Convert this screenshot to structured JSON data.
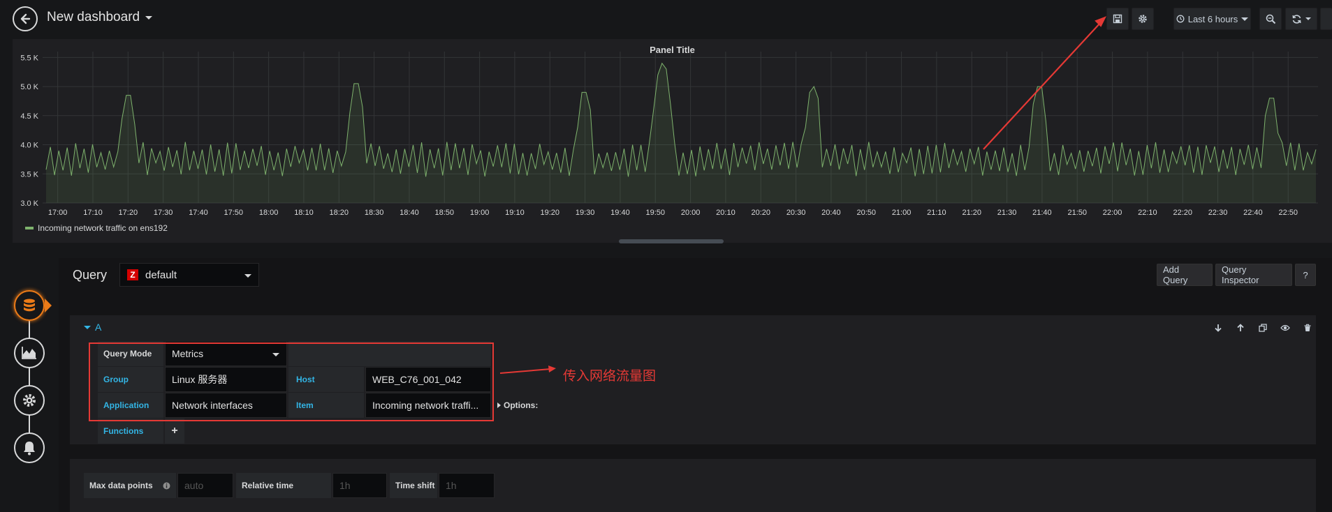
{
  "navbar": {
    "title": "New dashboard",
    "time_range": "Last 6 hours",
    "icons": [
      "back-arrow-icon",
      "save-icon",
      "gear-icon",
      "clock-icon",
      "zoom-out-icon",
      "refresh-icon"
    ]
  },
  "panel": {
    "title": "Panel Title",
    "legend": "Incoming network traffic on ens192"
  },
  "chart_data": {
    "type": "line",
    "title": "Panel Title",
    "xlabel": "",
    "ylabel": "",
    "ylim": [
      3.0,
      5.6
    ],
    "y_ticks": [
      "3.0 K",
      "3.5 K",
      "4.0 K",
      "4.5 K",
      "5.0 K",
      "5.5 K"
    ],
    "x_ticks": [
      "17:00",
      "17:10",
      "17:20",
      "17:30",
      "17:40",
      "17:50",
      "18:00",
      "18:10",
      "18:20",
      "18:30",
      "18:40",
      "18:50",
      "19:00",
      "19:10",
      "19:20",
      "19:30",
      "19:40",
      "19:50",
      "20:00",
      "20:10",
      "20:20",
      "20:30",
      "20:40",
      "20:50",
      "21:00",
      "21:10",
      "21:20",
      "21:30",
      "21:40",
      "21:50",
      "22:00",
      "22:10",
      "22:20",
      "22:30",
      "22:40",
      "22:50"
    ],
    "grid": true,
    "legend_position": "bottom-left",
    "color": "#7eb26d",
    "series": [
      {
        "name": "Incoming network traffic on ens192",
        "baseline_range": [
          3.5,
          4.0
        ],
        "spikes": [
          {
            "x": "17:20",
            "y": 4.85
          },
          {
            "x": "18:25",
            "y": 5.05
          },
          {
            "x": "19:30",
            "y": 4.9
          },
          {
            "x": "19:52",
            "y": 5.4
          },
          {
            "x": "20:35",
            "y": 5.0
          },
          {
            "x": "21:39",
            "y": 5.0
          },
          {
            "x": "22:45",
            "y": 4.8
          }
        ]
      }
    ]
  },
  "editor": {
    "query_label": "Query",
    "datasource_badge": "Z",
    "datasource": "default",
    "add_query": "Add Query",
    "query_inspector": "Query Inspector",
    "help": "?",
    "query_ref": "A",
    "row_icons": [
      "arrow-down-icon",
      "arrow-up-icon",
      "duplicate-icon",
      "eye-icon",
      "trash-icon"
    ],
    "query_mode_label": "Query Mode",
    "query_mode_value": "Metrics",
    "group_label": "Group",
    "group_value": "Linux 服务器",
    "host_label": "Host",
    "host_value": "WEB_C76_001_042",
    "application_label": "Application",
    "application_value": "Network interfaces",
    "item_label": "Item",
    "item_value": "Incoming network traffi...",
    "options_label": "Options:",
    "functions_label": "Functions",
    "functions_add": "+",
    "max_data_points_label": "Max data points",
    "max_data_points_placeholder": "auto",
    "relative_time_label": "Relative time",
    "relative_time_placeholder": "1h",
    "time_shift_label": "Time shift",
    "time_shift_placeholder": "1h"
  },
  "annotation": {
    "text": "传入网络流量图",
    "color": "#e53935"
  }
}
